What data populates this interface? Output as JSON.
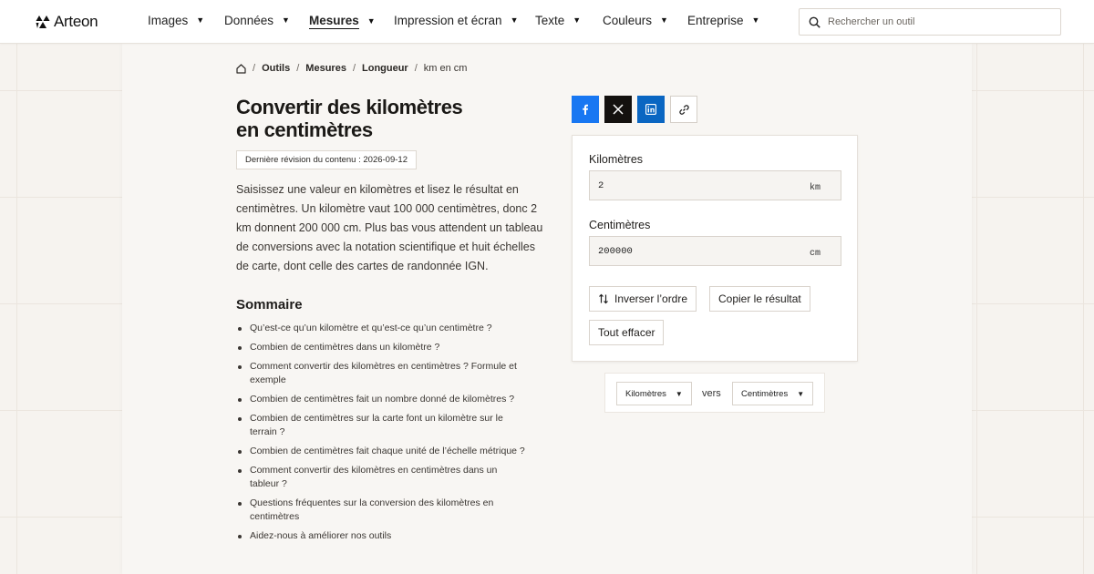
{
  "brand": {
    "name": "Arteon"
  },
  "nav": {
    "items": [
      {
        "label": "Images",
        "active": false
      },
      {
        "label": "Données",
        "active": false
      },
      {
        "label": "Mesures",
        "active": true
      },
      {
        "label": "Impression et écran",
        "active": false
      },
      {
        "label": "Texte",
        "active": false
      },
      {
        "label": "Couleurs",
        "active": false
      },
      {
        "label": "Entreprise",
        "active": false
      }
    ],
    "caret": "▼"
  },
  "search": {
    "placeholder": "Rechercher un outil",
    "icon": "search-icon"
  },
  "breadcrumb": {
    "home_icon": "home-icon",
    "separator": "/",
    "items": [
      "Outils",
      "Mesures",
      "Longueur"
    ],
    "current": "km en cm"
  },
  "page": {
    "title_line1": "Convertir des kilomètres",
    "title_line2": "en centimètres",
    "revision": "Dernière révision du contenu : 2026-09-12",
    "intro": "Saisissez une valeur en kilomètres et lisez le résultat en centimètres. Un kilomètre vaut 100 000 centimètres, donc 2 km donnent 200 000 cm. Plus bas vous attendent un tableau de conversions avec la notation scientifique et huit échelles de carte, dont celle des cartes de randonnée IGN."
  },
  "summary": {
    "title": "Sommaire",
    "items": [
      "Qu’est-ce qu’un kilomètre et qu’est-ce qu’un centimètre ?",
      "Combien de centimètres dans un kilomètre ?",
      "Comment convertir des kilomètres en centimètres ? Formule et exemple",
      "Combien de centimètres fait un nombre donné de kilomètres ?",
      "Combien de centimètres sur la carte font un kilomètre sur le terrain ?",
      "Combien de centimètres fait chaque unité de l’échelle métrique ?",
      "Comment convertir des kilomètres en centimètres dans un tableur ?",
      "Questions fréquentes sur la conversion des kilomètres en centimètres",
      "Aidez-nous à améliorer nos outils"
    ]
  },
  "share": {
    "icons": [
      "facebook-icon",
      "x-icon",
      "linkedin-icon",
      "link-icon"
    ],
    "colors": {
      "facebook": "#1877f2",
      "x": "#14110f",
      "linkedin": "#0a66c2"
    }
  },
  "converter": {
    "from_label": "Kilomètres",
    "from_value": "2",
    "from_unit": "km",
    "to_label": "Centimètres",
    "to_value": "200000",
    "to_unit": "cm",
    "swap_label": "Inverser l’ordre",
    "copy_label": "Copier le résultat",
    "clear_label": "Tout effacer"
  },
  "unit_select": {
    "from": "Kilomètres",
    "connector": "vers",
    "to": "Centimètres",
    "caret": "▼"
  }
}
